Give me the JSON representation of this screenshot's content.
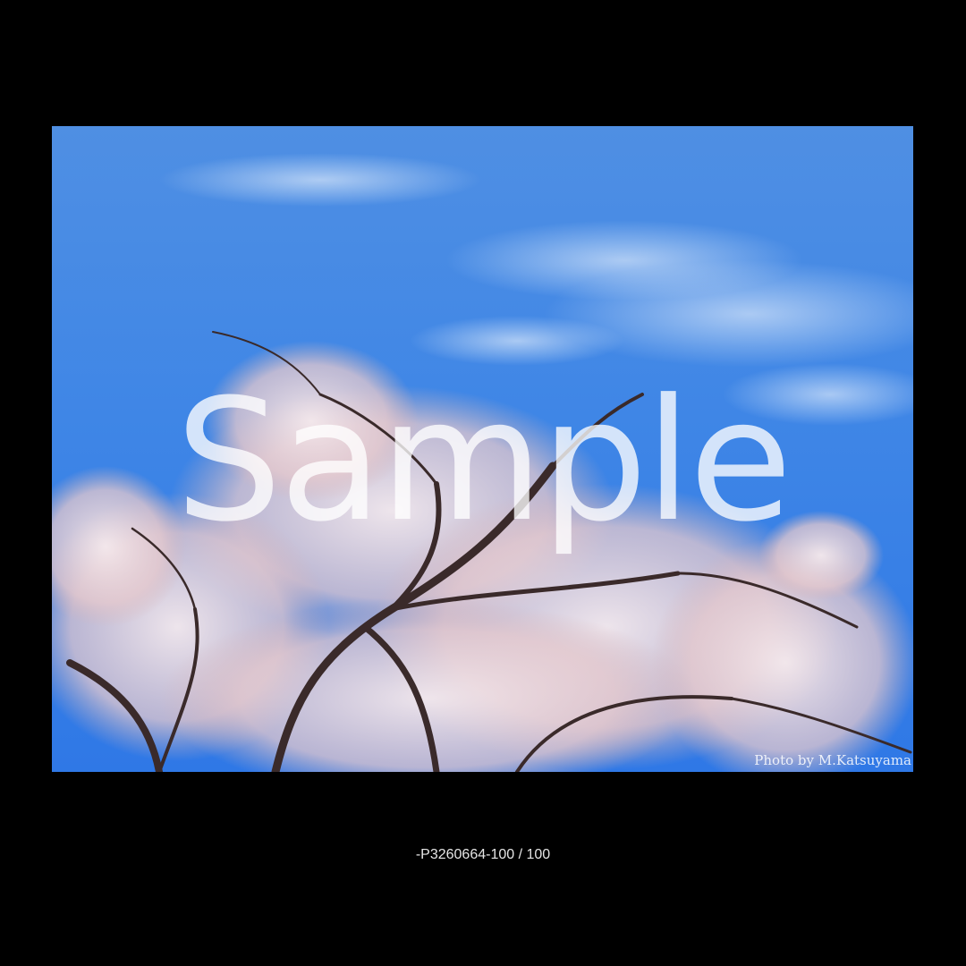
{
  "photo": {
    "watermark": "Sample",
    "credit": "Photo by M.Katsuyama",
    "subject": "cherry blossom tree against blue sky"
  },
  "caption": "-P3260664-100 / 100",
  "colors": {
    "background": "#000000",
    "sky": "#3f86e6",
    "blossom": "#f3e3e6",
    "branch": "#3a2a2a"
  }
}
